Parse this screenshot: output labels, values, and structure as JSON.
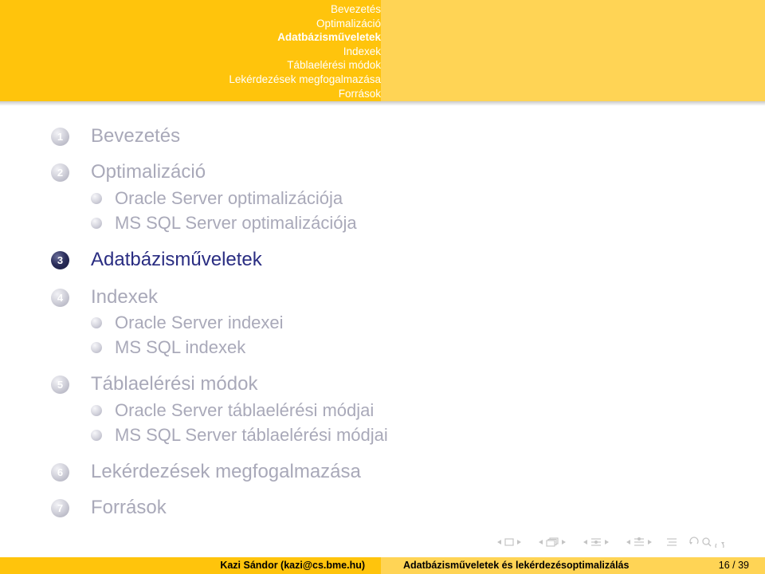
{
  "header": {
    "nav": [
      {
        "label": "Bevezetés",
        "active": false
      },
      {
        "label": "Optimalizáció",
        "active": false
      },
      {
        "label": "Adatbázisműveletek",
        "active": true
      },
      {
        "label": "Indexek",
        "active": false
      },
      {
        "label": "Táblaelérési módok",
        "active": false
      },
      {
        "label": "Lekérdezések megfogalmazása",
        "active": false
      },
      {
        "label": "Források",
        "active": false
      }
    ]
  },
  "outline": {
    "sections": [
      {
        "number": "1",
        "title": "Bevezetés"
      },
      {
        "number": "2",
        "title": "Optimalizáció",
        "subsections": [
          "Oracle Server optimalizációja",
          "MS SQL Server optimalizációja"
        ]
      },
      {
        "number": "3",
        "title": "Adatbázisműveletek",
        "current": true
      },
      {
        "number": "4",
        "title": "Indexek",
        "subsections": [
          "Oracle Server indexei",
          "MS SQL indexek"
        ]
      },
      {
        "number": "5",
        "title": "Táblaelérési módok",
        "subsections": [
          "Oracle Server táblaelérési módjai",
          "MS SQL Server táblaelérési módjai"
        ]
      },
      {
        "number": "6",
        "title": "Lekérdezések megfogalmazása"
      },
      {
        "number": "7",
        "title": "Források"
      }
    ]
  },
  "footer": {
    "author": "Kazi Sándor (kazi@cs.bme.hu)",
    "title": "Adatbázisműveletek és lekérdezésoptimalizálás",
    "page": "16 / 39"
  },
  "navigation_icons": [
    "slide-nav-icon",
    "frame-nav-icon",
    "subsection-nav-icon",
    "section-nav-icon",
    "outline-icon",
    "search-icon"
  ],
  "colors": {
    "header_dark": "#ffc40c",
    "header_light": "#ffd455",
    "current_section": "#2a2d82",
    "inactive_text": "#a9a9b9"
  }
}
